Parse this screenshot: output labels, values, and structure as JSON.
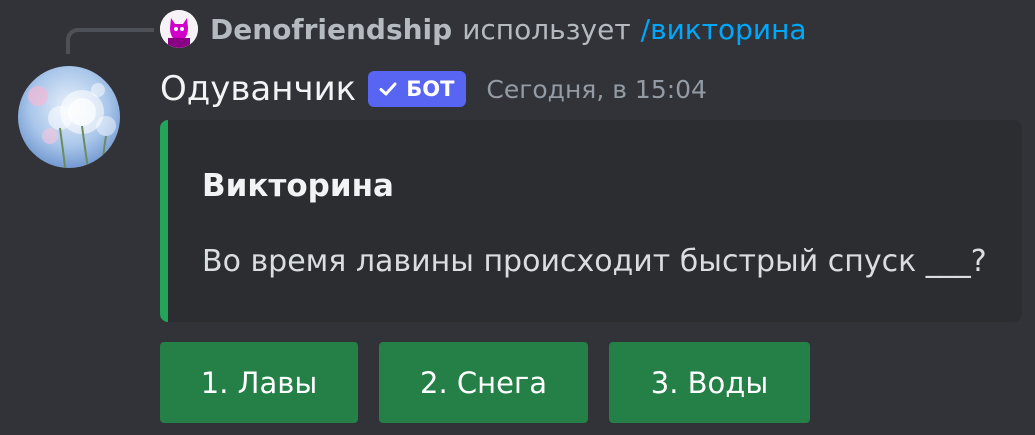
{
  "reply": {
    "username": "Denofriendship",
    "action": "использует",
    "command": "/викторина",
    "avatar_icon": "user-avatar-pink-cat"
  },
  "message": {
    "author": "Одуванчик",
    "bot_tag": "БОТ",
    "timestamp": "Сегодня, в 15:04",
    "avatar_icon": "dandelion-avatar"
  },
  "embed": {
    "title": "Викторина",
    "description": "Во время лавины происходит быстрый спуск ___?",
    "accent_color": "#23a559"
  },
  "buttons": [
    {
      "label": "1. Лавы"
    },
    {
      "label": "2. Снега"
    },
    {
      "label": "3. Воды"
    }
  ],
  "colors": {
    "background": "#313338",
    "embed_background": "#2b2d31",
    "bot_tag": "#5865f2",
    "button_success": "#248046",
    "command_link": "#00a8fc"
  }
}
